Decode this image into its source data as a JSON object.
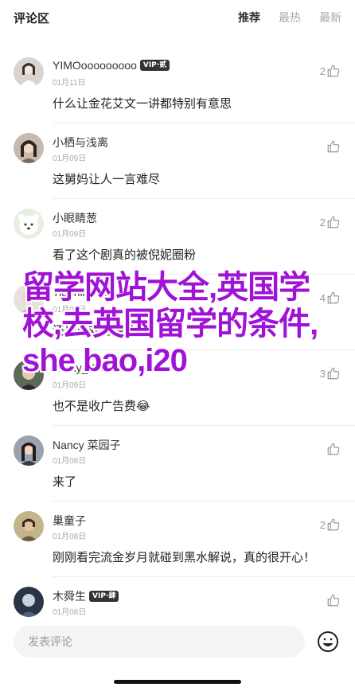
{
  "header": {
    "title": "评论区",
    "tabs": [
      {
        "label": "推荐",
        "active": true
      },
      {
        "label": "最热",
        "active": false
      },
      {
        "label": "最新",
        "active": false
      }
    ]
  },
  "comments": [
    {
      "name": "YIMOooooooooo",
      "badge": "VIP·贰",
      "date": "01月11日",
      "text": "什么让金花艾文一讲都特别有意思",
      "likes": "2"
    },
    {
      "name": "小栖与浅离",
      "badge": "",
      "date": "01月09日",
      "text": "这舅妈让人一言难尽",
      "likes": ""
    },
    {
      "name": "小眼睛葱",
      "badge": "",
      "date": "01月09日",
      "text": "看了这个剧真的被倪妮圈粉",
      "likes": "2"
    },
    {
      "name": "Tigerlily6666",
      "badge": "",
      "date": "01月09日",
      "text": "还是小刘有缘给给",
      "likes": "4"
    },
    {
      "name": "Lucky_Kiki",
      "badge": "",
      "date": "01月09日",
      "text": "也不是收广告费😂",
      "likes": "3"
    },
    {
      "name": "Nancy 菜园子",
      "badge": "",
      "date": "01月08日",
      "text": "来了",
      "likes": ""
    },
    {
      "name": "巢童子",
      "badge": "",
      "date": "01月08日",
      "text": "刚刚看完流金岁月就碰到黑水解说，真的很开心！",
      "likes": "2"
    },
    {
      "name": "木舜生",
      "badge": "VIP·肆",
      "date": "01月08日",
      "text": "",
      "likes": ""
    }
  ],
  "overlay": {
    "text": "留学网站大全,英国学校,去英国留学的条件,she bao,i20"
  },
  "footer": {
    "input_placeholder": "发表评论"
  },
  "colors": {
    "overlay": "#a013d6",
    "accent_text": "#333333",
    "muted": "#a8a8a8"
  },
  "icons": {
    "like": "thumbs-up-icon",
    "emoji": "smiley-face-icon"
  }
}
